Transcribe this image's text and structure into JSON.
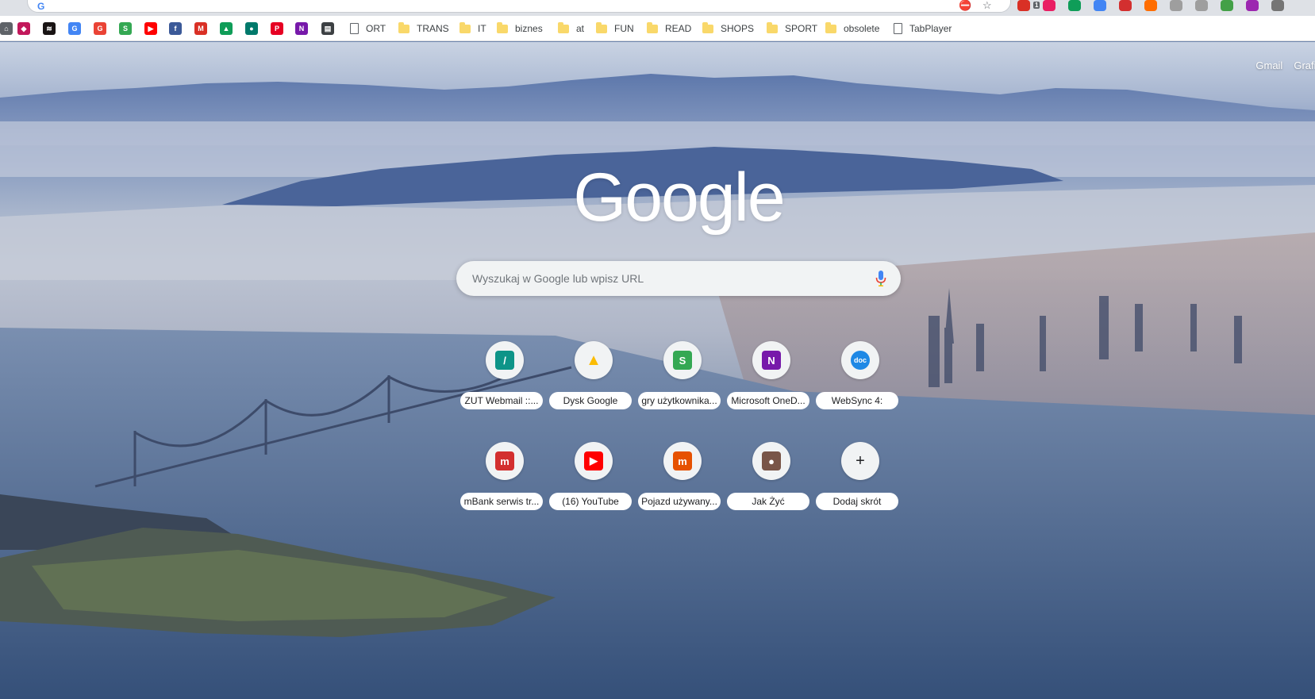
{
  "browser": {
    "omnibox_value": "",
    "favicon_letter": "G",
    "bookmark_icons": [
      {
        "name": "home-icon",
        "color": "#5f6368",
        "glyph": "⌂"
      },
      {
        "name": "shield-extension-icon",
        "color": "#c2185b",
        "glyph": "◆"
      },
      {
        "name": "spotify-icon",
        "color": "#191414",
        "glyph": "≋"
      },
      {
        "name": "google-translate-icon",
        "color": "#4285f4",
        "glyph": "G"
      },
      {
        "name": "google-icon",
        "color": "#ea4335",
        "glyph": "G"
      },
      {
        "name": "puzzle-game-icon",
        "color": "#34a853",
        "glyph": "S"
      },
      {
        "name": "youtube-icon",
        "color": "#ff0000",
        "glyph": "▶"
      },
      {
        "name": "facebook-icon",
        "color": "#3b5998",
        "glyph": "f"
      },
      {
        "name": "gmail-icon",
        "color": "#d93025",
        "glyph": "M"
      },
      {
        "name": "google-drive-icon",
        "color": "#0f9d58",
        "glyph": "▲"
      },
      {
        "name": "teal-site-icon",
        "color": "#00796b",
        "glyph": "●"
      },
      {
        "name": "pinterest-icon",
        "color": "#e60023",
        "glyph": "P"
      },
      {
        "name": "onenote-icon",
        "color": "#7719aa",
        "glyph": "N"
      },
      {
        "name": "printer-icon",
        "color": "#3c4043",
        "glyph": "▤"
      }
    ],
    "bookmark_items": [
      {
        "type": "page",
        "label": "ORT"
      },
      {
        "type": "folder",
        "label": "TRANS"
      },
      {
        "type": "folder",
        "label": "IT"
      },
      {
        "type": "folder",
        "label": "biznes"
      },
      {
        "type": "folder",
        "label": "at"
      },
      {
        "type": "folder",
        "label": "FUN"
      },
      {
        "type": "folder",
        "label": "READ"
      },
      {
        "type": "folder",
        "label": "SHOPS"
      },
      {
        "type": "folder",
        "label": "SPORT"
      },
      {
        "type": "folder",
        "label": "obsolete"
      },
      {
        "type": "page",
        "label": "TabPlayer"
      }
    ],
    "extension_colors": [
      "#d93025",
      "#e91e63",
      "#0f9d58",
      "#4285f4",
      "#d32f2f",
      "#ff6d00",
      "#9e9e9e",
      "#9e9e9e",
      "#43a047",
      "#9c27b0",
      "#757575"
    ],
    "extension_badge": "1"
  },
  "google": {
    "top_links": [
      "Gmail",
      "Grafik"
    ],
    "logo_text": "Google",
    "search_placeholder": "Wyszukaj w Google lub wpisz URL"
  },
  "shortcuts": [
    {
      "label": "ZUT Webmail ::...",
      "icon": "zut-webmail-icon",
      "glyph": "/",
      "color": "#0d9488"
    },
    {
      "label": "Dysk Google",
      "icon": "google-drive-icon",
      "glyph": "▲",
      "color": "#fbbc04"
    },
    {
      "label": "gry użytkownika...",
      "icon": "puzzle-game-icon",
      "glyph": "S",
      "color": "#34a853"
    },
    {
      "label": "Microsoft OneD...",
      "icon": "onenote-icon",
      "glyph": "N",
      "color": "#7719aa"
    },
    {
      "label": "WebSync 4:",
      "icon": "doc-sync-icon",
      "glyph": "doc",
      "color": "#1e88e5"
    },
    {
      "label": "mBank serwis tr...",
      "icon": "mbank-icon",
      "glyph": "m",
      "color": "#d32f2f"
    },
    {
      "label": "(16) YouTube",
      "icon": "youtube-icon",
      "glyph": "▶",
      "color": "#ff0000"
    },
    {
      "label": "Pojazd używany...",
      "icon": "otomoto-icon",
      "glyph": "m",
      "color": "#e65100"
    },
    {
      "label": "Jak Żyć",
      "icon": "jak-zyc-icon",
      "glyph": "●",
      "color": "#795548"
    },
    {
      "label": "Dodaj skrót",
      "icon": "plus-icon",
      "glyph": "+",
      "color": "#202124"
    }
  ]
}
